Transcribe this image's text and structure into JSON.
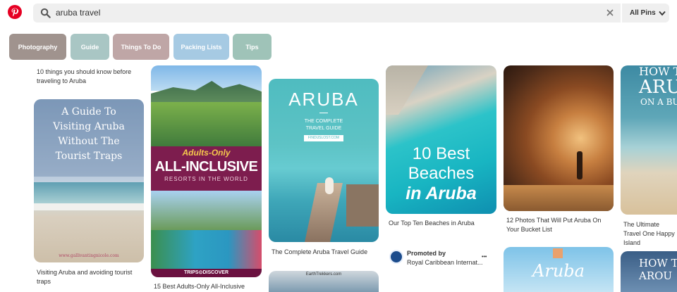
{
  "search": {
    "query": "aruba travel",
    "scope": "All Pins"
  },
  "chips": [
    "Photography",
    "Guide",
    "Things To Do",
    "Packing Lists",
    "Tips"
  ],
  "colors": {
    "brand": "#e60023",
    "chip_photography": "#a0938e",
    "chip_guide": "#a9c6c4",
    "chip_things": "#bfa6a6",
    "chip_packing": "#a6cae3",
    "chip_tips": "#9fc3b8"
  },
  "pins": {
    "col1_top_caption": "10 things you should know before traveling to Aruba",
    "col1": {
      "title_lines": [
        "A Guide To",
        "Visiting Aruba",
        "Without The",
        "Tourist Traps"
      ],
      "url": "www.gallivantingnicole.com",
      "caption": "Visiting Aruba and avoiding tourist traps"
    },
    "col2": {
      "badge_top": "Adults-Only",
      "badge_main": "ALL-INCLUSIVE",
      "badge_sub": "RESORTS IN THE WORLD",
      "brand": "TRIPS⊙DISCOVER",
      "caption": "15 Best Adults-Only All-Inclusive"
    },
    "col3": {
      "title": "ARUBA",
      "subtitle": "THE COMPLETE TRAVEL GUIDE",
      "site": "FINDUSLOST.COM",
      "caption": "The Complete Aruba Travel Guide",
      "next_site": "EarthTrekkers.com"
    },
    "col4": {
      "title_lines": [
        "10 Best",
        "Beaches",
        "in Aruba"
      ],
      "caption": "Our Top Ten Beaches in Aruba",
      "promoted_label": "Promoted by",
      "promoter": "Royal Caribbean Internat...",
      "more": "•••"
    },
    "col5": {
      "caption": "12 Photos That Will Put Aruba On Your Bucket List",
      "next_label": "Aruba"
    },
    "col6": {
      "title_lines": [
        "HOW T",
        "ARU",
        "ON A BU"
      ],
      "caption": "The Ultimate Travel One Happy Island",
      "next_lines": [
        "HOW T",
        "AROU"
      ]
    }
  }
}
